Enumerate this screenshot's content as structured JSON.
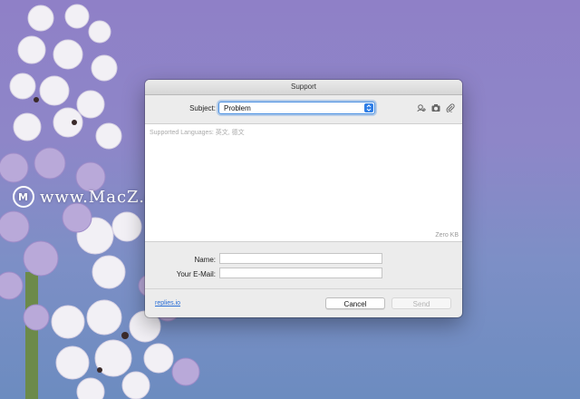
{
  "watermark": {
    "logo": "M",
    "text": "www.MacZ.com"
  },
  "window": {
    "title": "Support",
    "subject_label": "Subject:",
    "subject_value": "Problem",
    "icons": [
      "add-contact-icon",
      "camera-icon",
      "paperclip-icon"
    ],
    "message_placeholder": "Supported Languages: 英文, 德文",
    "size_label": "Zero KB",
    "name_label": "Name:",
    "name_value": "",
    "email_label": "Your E-Mail:",
    "email_value": "",
    "footer_link": "replies.io",
    "cancel_label": "Cancel",
    "send_label": "Send"
  },
  "colors": {
    "accent": "#2f7ee6",
    "link": "#2a6fd6"
  }
}
